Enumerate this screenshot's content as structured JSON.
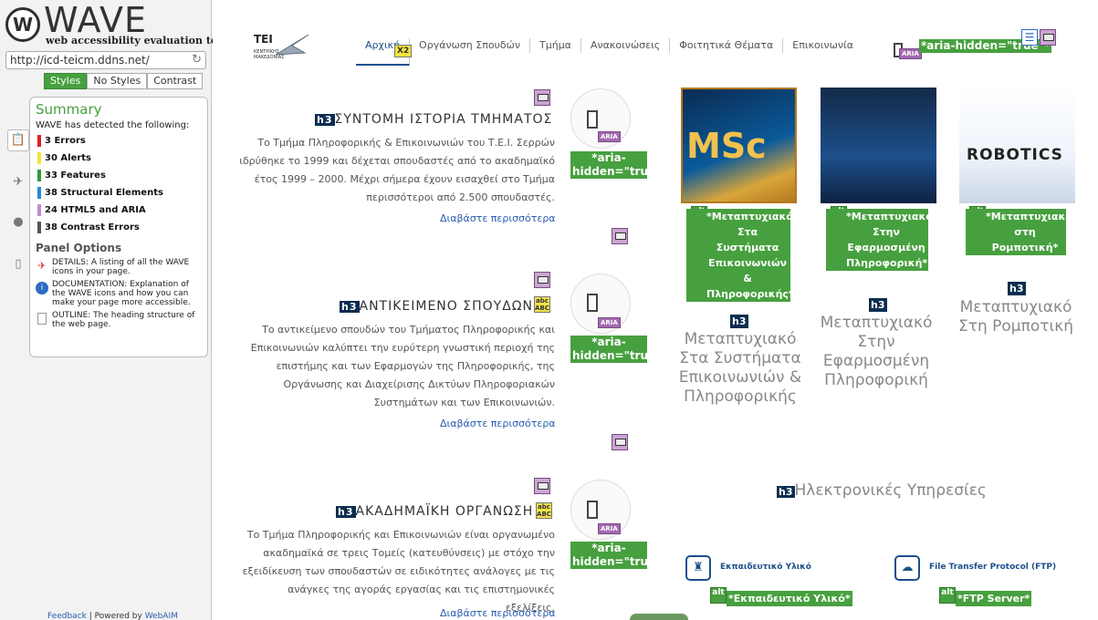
{
  "sidebar": {
    "logo_text": "WAVE",
    "tagline": "web accessibility evaluation tool",
    "url": "http://icd-teicm.ddns.net/",
    "view_tabs": [
      "Styles",
      "No Styles",
      "Contrast"
    ],
    "summary": {
      "title": "Summary",
      "detected": "WAVE has detected the following:",
      "rows": [
        {
          "label": "3 Errors",
          "color": "#e02020"
        },
        {
          "label": "30 Alerts",
          "color": "#f3e43a"
        },
        {
          "label": "33 Features",
          "color": "#2f9a3a"
        },
        {
          "label": "38 Structural Elements",
          "color": "#2b87d8"
        },
        {
          "label": "24 HTML5 and ARIA",
          "color": "#c48ad6"
        },
        {
          "label": "38 Contrast Errors",
          "color": "#555555"
        }
      ],
      "panel_options_title": "Panel Options",
      "options": [
        {
          "icon": "tag-icon",
          "text": "DETAILS: A listing of all the WAVE icons in your page."
        },
        {
          "icon": "info-icon",
          "text": "DOCUMENTATION: Explanation of the WAVE icons and how you can make your page more accessible."
        },
        {
          "icon": "outline-icon",
          "text": "OUTLINE: The heading structure of the web page."
        }
      ]
    },
    "feedback": "Feedback",
    "powered": "Powered by",
    "webaim": "WebAIM"
  },
  "site": {
    "logo_main": "TEI",
    "logo_sub": "ΚΕΝΤΡΙΚΗΣ ΜΑΚΕΔΟΝΙΑΣ",
    "nav": [
      "Αρχική",
      "Οργάνωση Σπουδών",
      "Τμήμα",
      "Ανακοινώσεις",
      "Φοιτητικά Θέματα",
      "Επικοινωνία"
    ],
    "x2": "X2",
    "aria_hidden": "*aria-hidden=\"true\"*",
    "aria_label": "ARIA",
    "h3": "h3",
    "abc": "abc ABC",
    "alt": "alt"
  },
  "sections": [
    {
      "title": "ΣΥΝΤΟΜΗ ΙΣΤΟΡΙΑ ΤΜΗΜΑΤΟΣ",
      "text": "Το Τμήμα Πληροφορικής & Επικοινωνιών του Τ.Ε.Ι. Σερρών ιδρύθηκε το 1999 και δέχεται σπουδαστές από το ακαδημαϊκό έτος 1999 – 2000. Μέχρι σήμερα έχουν εισαχθεί στο Τμήμα περισσότεροι από 2.500 σπουδαστές.",
      "more": "Διαβάστε περισσότερα"
    },
    {
      "title": "ΑΝΤΙΚΕΙΜΕΝΟ ΣΠΟΥΔΩΝ",
      "text": "Το αντικείμενο σπουδών του Τμήματος Πληροφορικής και Επικοινωνιών καλύπτει την ευρύτερη γνωστική περιοχή της επιστήμης και των Εφαρμογών της Πληροφορικής, της Οργάνωσης και Διαχείρισης Δικτύων Πληροφοριακών Συστημάτων και των Επικοινωνιών.",
      "more": "Διαβάστε περισσότερα"
    },
    {
      "title": "ΑΚΑΔΗΜΑΪΚΗ ΟΡΓΑΝΩΣΗ",
      "text": "Το Τμήμα Πληροφορικής και Επικοινωνιών είναι οργανωμένο ακαδημαϊκά σε τρεις Τομείς (κατευθύνσεις) με στόχο την εξειδίκευση των σπουδαστών σε ειδικότητες ανάλογες με τις ανάγκες της αγοράς εργασίας και τις επιστημονικές εξελίξεις.",
      "more": "Διαβάστε περισσότερα"
    }
  ],
  "programs": [
    {
      "alt": "*Μεταπτυχιακό Στα Συστήματα Επικοινωνιών & Πληροφορικής*",
      "title": "Μεταπτυχιακό Στα Συστήματα Επικοινωνιών & Πληροφορικής",
      "poster_text": "MSc"
    },
    {
      "alt": "*Μεταπτυχιακό Στην Εφαρμοσμένη Πληροφορική*",
      "title": "Μεταπτυχιακό Στην Εφαρμοσμένη Πληροφορική",
      "poster_text": ""
    },
    {
      "alt": "*Μεταπτυχιακό στη Ρομποτική*",
      "title": "Μεταπτυχιακό Στη Ρομποτική",
      "poster_text": "ROBOTICS"
    }
  ],
  "services": {
    "title": "Ηλεκτρονικές Υπηρεσίες",
    "items": [
      {
        "label": "Εκπαιδευτικό Υλικό",
        "alt": "*Εκπαιδευτικό Υλικό*",
        "icon": "education-icon"
      },
      {
        "label": "File Transfer Protocol (FTP)",
        "alt": "*FTP Server*",
        "icon": "cloud-icon"
      }
    ]
  }
}
